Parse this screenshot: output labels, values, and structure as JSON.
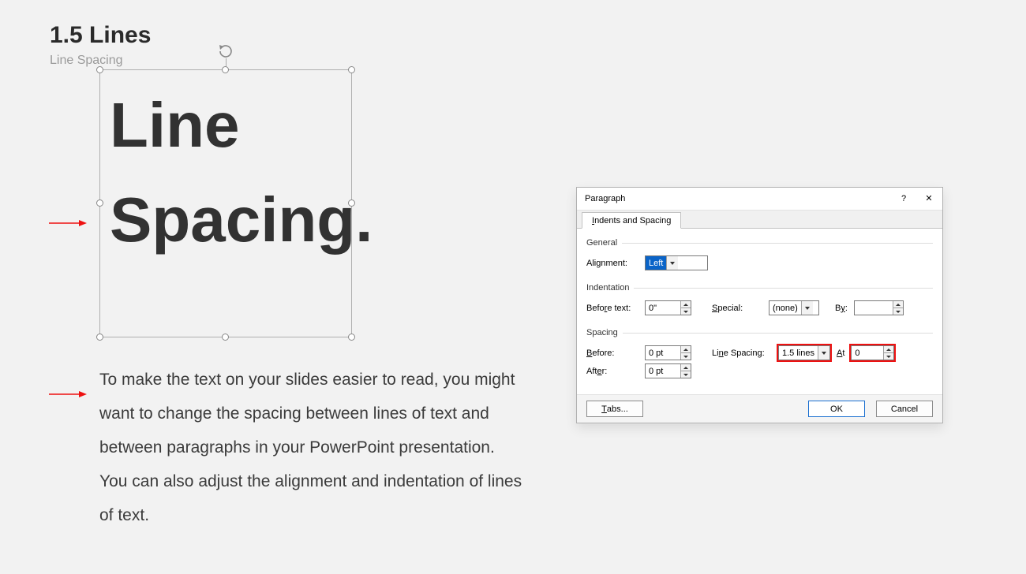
{
  "header": {
    "title": "1.5 Lines",
    "subtitle": "Line Spacing"
  },
  "textbox": {
    "line1": "Line",
    "line2": "Spacing."
  },
  "body": "To make the text on your slides easier to read, you might want to change the spacing between lines of text and between paragraphs in your PowerPoint presentation. You can also adjust the alignment and indentation of lines of text.",
  "dialog": {
    "title": "Paragraph",
    "help": "?",
    "close": "✕",
    "tab": "Indents and Spacing",
    "general": {
      "legend": "General",
      "alignment_label": "Alignment:",
      "alignment_value": "Left"
    },
    "indentation": {
      "legend": "Indentation",
      "before_text_label": "Before text:",
      "before_text_value": "0\"",
      "special_label": "Special:",
      "special_value": "(none)",
      "by_label": "By:",
      "by_value": ""
    },
    "spacing": {
      "legend": "Spacing",
      "before_label": "Before:",
      "before_value": "0 pt",
      "after_label": "After:",
      "after_value": "0 pt",
      "line_spacing_label": "Line Spacing:",
      "line_spacing_value": "1.5 lines",
      "at_label": "At",
      "at_value": "0"
    },
    "footer": {
      "tabs": "Tabs...",
      "ok": "OK",
      "cancel": "Cancel"
    }
  }
}
